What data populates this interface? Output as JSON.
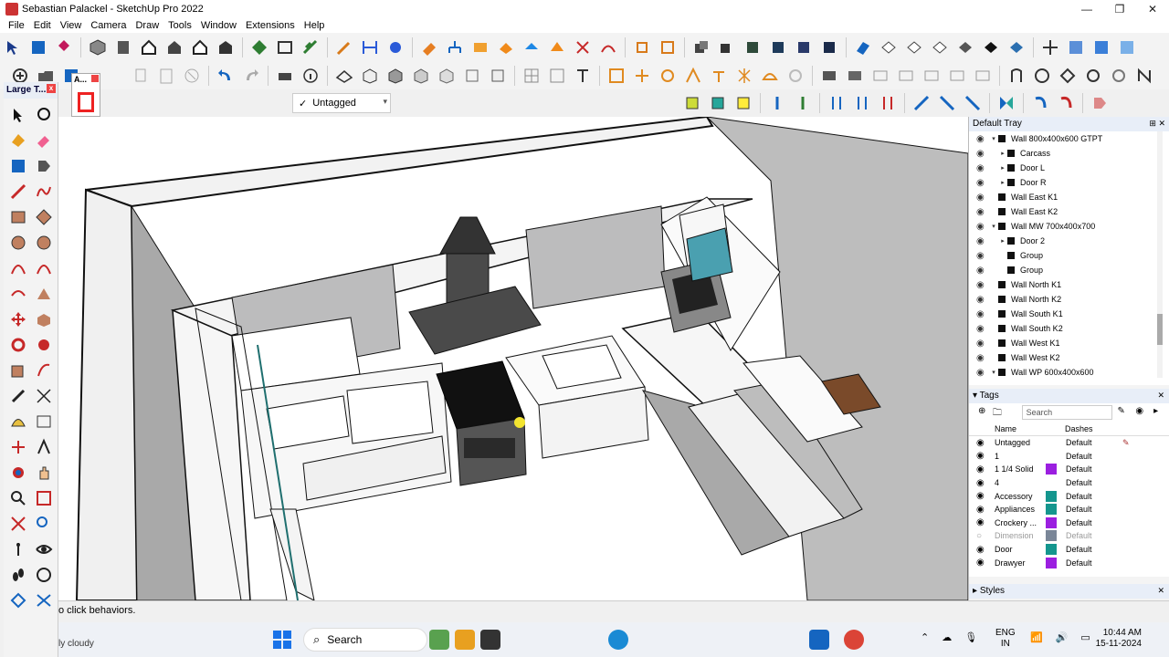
{
  "window": {
    "title": "Sebastian Palackel - SketchUp Pro 2022",
    "controls": [
      "—",
      "❐",
      "✕"
    ]
  },
  "menu": [
    "File",
    "Edit",
    "View",
    "Camera",
    "Draw",
    "Tools",
    "Window",
    "Extensions",
    "Help"
  ],
  "toolbar": {
    "tag_dropdown_value": "Untagged"
  },
  "palette": {
    "title": "Large T...",
    "mini_title": "A..."
  },
  "tray": {
    "title": "Default Tray",
    "outliner": [
      {
        "label": "Wall 800x400x600 GTPT",
        "expanded": true,
        "indent": 0
      },
      {
        "label": "Carcass",
        "expanded": false,
        "indent": 1
      },
      {
        "label": "Door L",
        "expanded": false,
        "indent": 1
      },
      {
        "label": "Door R",
        "expanded": false,
        "indent": 1
      },
      {
        "label": "Wall East K1",
        "expanded": null,
        "indent": 0
      },
      {
        "label": "Wall East K2",
        "expanded": null,
        "indent": 0
      },
      {
        "label": "Wall MW 700x400x700",
        "expanded": true,
        "indent": 0
      },
      {
        "label": "Door 2",
        "expanded": false,
        "indent": 1
      },
      {
        "label": "Group",
        "expanded": null,
        "indent": 1
      },
      {
        "label": "Group",
        "expanded": null,
        "indent": 1
      },
      {
        "label": "Wall North K1",
        "expanded": null,
        "indent": 0
      },
      {
        "label": "Wall North K2",
        "expanded": null,
        "indent": 0
      },
      {
        "label": "Wall South K1",
        "expanded": null,
        "indent": 0
      },
      {
        "label": "Wall South K2",
        "expanded": null,
        "indent": 0
      },
      {
        "label": "Wall West K1",
        "expanded": null,
        "indent": 0
      },
      {
        "label": "Wall West K2",
        "expanded": null,
        "indent": 0
      },
      {
        "label": "Wall WP 600x400x600",
        "expanded": true,
        "indent": 0
      }
    ],
    "tags": {
      "title": "Tags",
      "search_placeholder": "Search",
      "col_name": "Name",
      "col_dashes": "Dashes",
      "rows": [
        {
          "name": "Untagged",
          "color": null,
          "dashes": "Default",
          "visible": true
        },
        {
          "name": "1",
          "color": null,
          "dashes": "Default",
          "visible": true
        },
        {
          "name": "1 1/4 Solid",
          "color": "#9b1fe0",
          "dashes": "Default",
          "visible": true
        },
        {
          "name": "4",
          "color": null,
          "dashes": "Default",
          "visible": true
        },
        {
          "name": "Accessory",
          "color": "#14968e",
          "dashes": "Default",
          "visible": true
        },
        {
          "name": "Appliances",
          "color": "#14968e",
          "dashes": "Default",
          "visible": true
        },
        {
          "name": "Crockery ...",
          "color": "#9b1fe0",
          "dashes": "Default",
          "visible": true
        },
        {
          "name": "Dimension",
          "color": "#7a8698",
          "dashes": "Default",
          "visible": false
        },
        {
          "name": "Door",
          "color": "#14968e",
          "dashes": "Default",
          "visible": true
        },
        {
          "name": "Drawyer",
          "color": "#9b1fe0",
          "dashes": "Default",
          "visible": true
        }
      ]
    },
    "styles_title": "Styles"
  },
  "status": {
    "text": "o click behaviors."
  },
  "taskbar": {
    "weather": "ly cloudy",
    "search_label": "Search",
    "lang_line1": "ENG",
    "lang_line2": "IN",
    "time": "10:44 AM",
    "date": "15-11-2024"
  }
}
